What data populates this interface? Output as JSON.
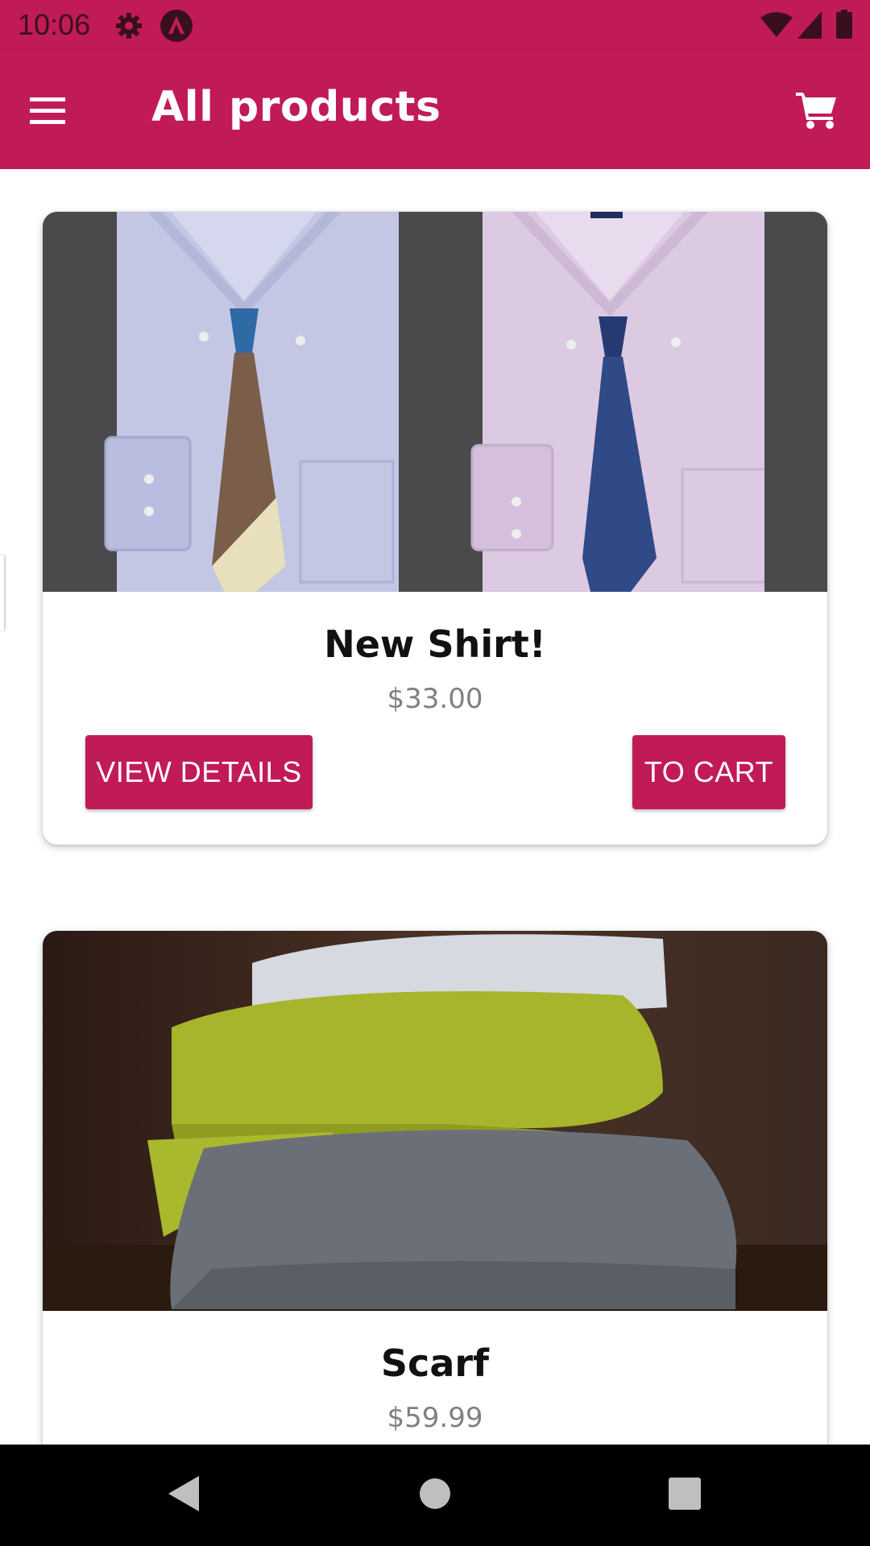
{
  "status_bar": {
    "time": "10:06",
    "icons": [
      "settings-icon",
      "app-notification-icon",
      "wifi-icon",
      "signal-icon",
      "battery-icon"
    ]
  },
  "app_bar": {
    "title": "All products",
    "menu_icon": "menu-icon",
    "cart_icon": "shopping-cart-icon",
    "color": "#c11b57"
  },
  "products": [
    {
      "name": "New Shirt!",
      "price": "$33.00",
      "image": "two folded dress shirts with ties",
      "details_label": "VIEW DETAILS",
      "cart_label": "TO CART"
    },
    {
      "name": "Scarf",
      "price": "$59.99",
      "image": "stack of knitted scarves"
    }
  ],
  "nav_bar": {
    "icons": [
      "back-icon",
      "home-icon",
      "recents-icon"
    ]
  }
}
